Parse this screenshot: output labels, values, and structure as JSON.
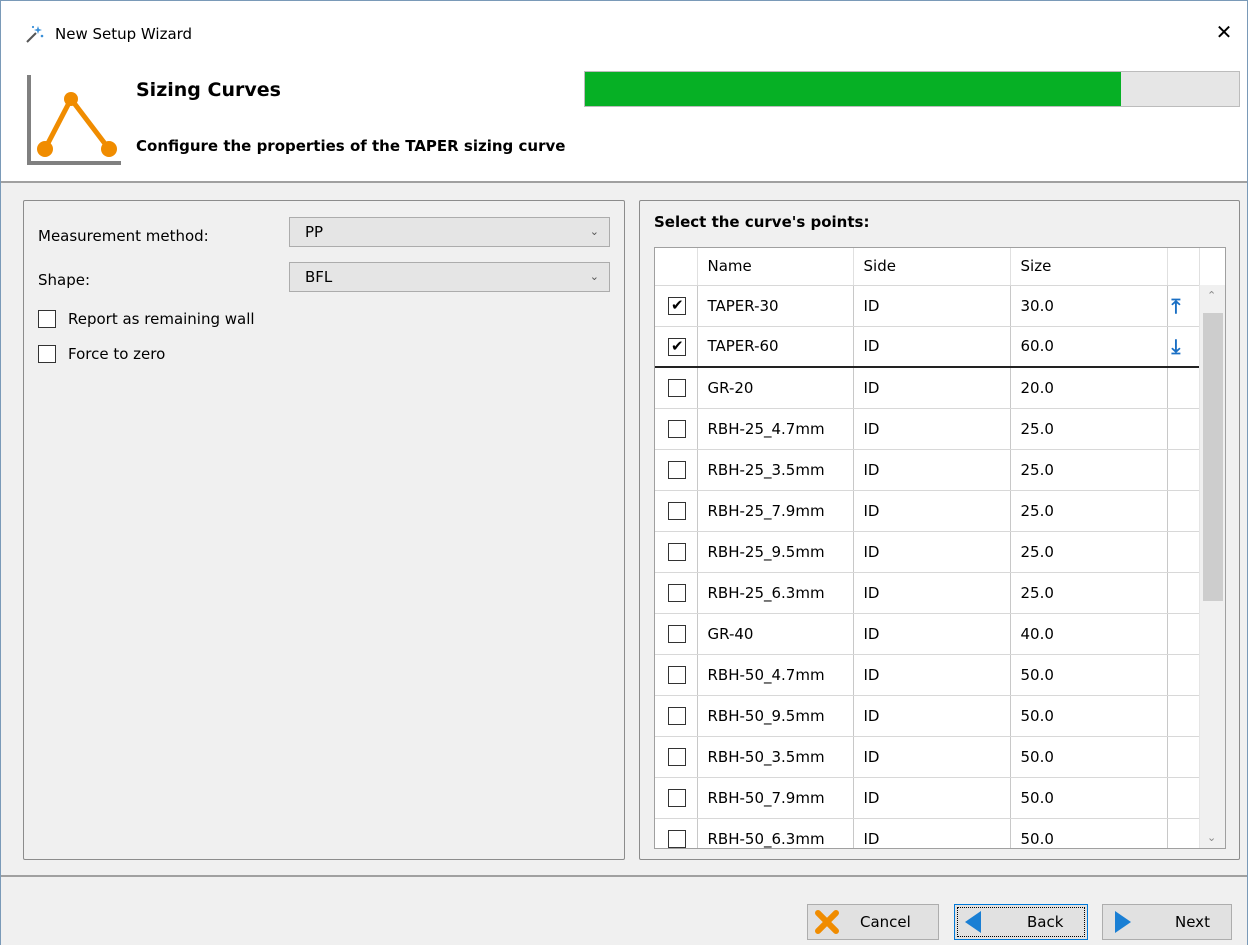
{
  "window": {
    "title": "New Setup Wizard",
    "close_glyph": "✕"
  },
  "header": {
    "title": "Sizing Curves",
    "subtitle": "Configure the properties of the TAPER sizing curve",
    "progress_fraction": 0.82,
    "progress_color": "#06b025",
    "accent_color": "#f08c00"
  },
  "left": {
    "measurement_label": "Measurement method:",
    "measurement_value": "PP",
    "shape_label": "Shape:",
    "shape_value": "BFL",
    "report_wall_label": "Report as remaining wall",
    "force_zero_label": "Force to zero"
  },
  "right": {
    "title": "Select the curve's points:",
    "columns": [
      "Name",
      "Side",
      "Size"
    ],
    "rows": [
      {
        "checked": true,
        "name": "TAPER-30",
        "side": "ID",
        "size": "30.0"
      },
      {
        "checked": true,
        "name": "TAPER-60",
        "side": "ID",
        "size": "60.0"
      },
      {
        "checked": false,
        "name": "GR-20",
        "side": "ID",
        "size": "20.0"
      },
      {
        "checked": false,
        "name": "RBH-25_4.7mm",
        "side": "ID",
        "size": "25.0"
      },
      {
        "checked": false,
        "name": "RBH-25_3.5mm",
        "side": "ID",
        "size": "25.0"
      },
      {
        "checked": false,
        "name": "RBH-25_7.9mm",
        "side": "ID",
        "size": "25.0"
      },
      {
        "checked": false,
        "name": "RBH-25_9.5mm",
        "side": "ID",
        "size": "25.0"
      },
      {
        "checked": false,
        "name": "RBH-25_6.3mm",
        "side": "ID",
        "size": "25.0"
      },
      {
        "checked": false,
        "name": "GR-40",
        "side": "ID",
        "size": "40.0"
      },
      {
        "checked": false,
        "name": "RBH-50_4.7mm",
        "side": "ID",
        "size": "50.0"
      },
      {
        "checked": false,
        "name": "RBH-50_9.5mm",
        "side": "ID",
        "size": "50.0"
      },
      {
        "checked": false,
        "name": "RBH-50_3.5mm",
        "side": "ID",
        "size": "50.0"
      },
      {
        "checked": false,
        "name": "RBH-50_7.9mm",
        "side": "ID",
        "size": "50.0"
      },
      {
        "checked": false,
        "name": "RBH-50_6.3mm",
        "side": "ID",
        "size": "50.0"
      }
    ],
    "move_up_glyph": "⤒",
    "move_down_glyph": "⤓"
  },
  "footer": {
    "cancel_label": "Cancel",
    "back_label": "Back",
    "next_label": "Next"
  }
}
